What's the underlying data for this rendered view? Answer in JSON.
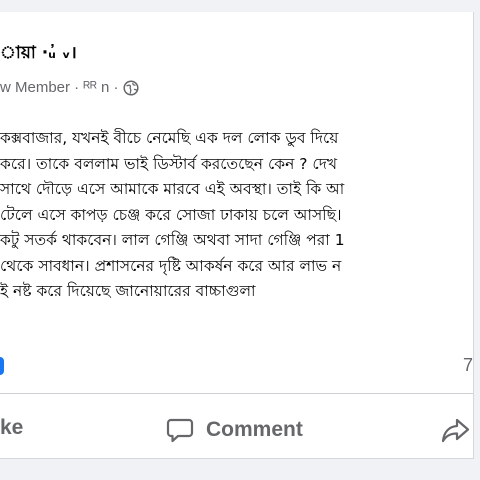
{
  "post": {
    "author_name": "ায়া ·ᵤ̓ ᵥ। ",
    "member_meta": "w Member · ᴿᴿ n ·",
    "privacy_icon": "globe-icon",
    "body_lines": [
      "কক্সবাজার, যখনই বীচে নেমেছি এক দল লোক ডুব দিয়ে",
      "করে। তাকে বললাম ভাই ডিস্টার্ব করতেছেন কেন ?  দেখ",
      "সাথে দৌড়ে এসে আমাকে মারবে এই অবস্থা।  তাই কি আ",
      "টেলে এসে কাপড় চেঞ্জ করে সোজা ঢাকায় চলে আসছি। ",
      "কটু সতর্ক থাকবেন।  লাল গেঞ্জি অথবা সাদা গেঞ্জি পরা 1",
      "থেকে সাবধান। প্রশাসনের দৃষ্টি আকর্ষন করে আর লাভ ন",
      "ই নষ্ট করে দিয়েছে জানোয়ারের বাচ্চাগুলা"
    ]
  },
  "stats": {
    "count_right": "7"
  },
  "actions": {
    "like_label": "ke",
    "comment_label": "Comment",
    "comment_icon": "comment-icon",
    "share_icon": "share-icon"
  },
  "colors": {
    "text_primary": "#050505",
    "text_secondary": "#65676b",
    "divider": "#ced0d4",
    "background": "#f0f2f5",
    "reaction_blue": "#1877f2"
  }
}
